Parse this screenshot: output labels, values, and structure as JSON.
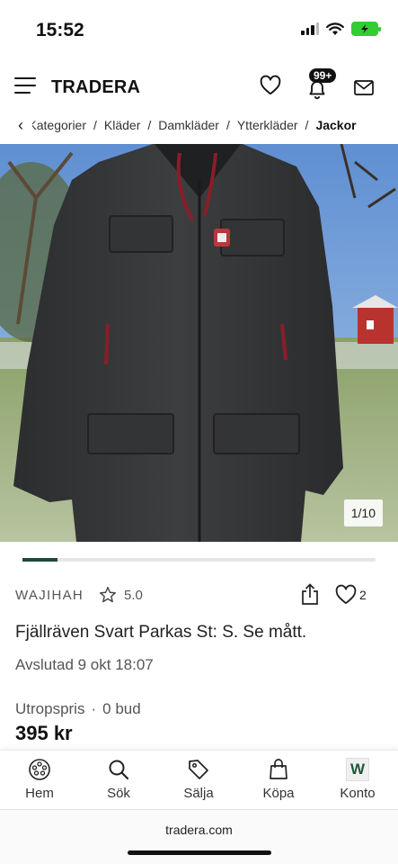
{
  "status": {
    "time": "15:52"
  },
  "header": {
    "logo": "TRADERA",
    "notification_badge": "99+"
  },
  "breadcrumb": {
    "items": [
      "Kategorier",
      "Kläder",
      "Damkläder",
      "Ytterkläder"
    ],
    "current": "Jackor"
  },
  "gallery": {
    "counter": "1/10",
    "current_index": 1,
    "total": 10
  },
  "listing": {
    "seller": "WAJIHAH",
    "rating": "5.0",
    "favorites": "2",
    "title": "Fjällräven Svart Parkas St: S. Se mått.",
    "ended": "Avslutad 9 okt 18:07",
    "price_type": "Utropspris",
    "separator": "·",
    "bids": "0 bud",
    "price": "395 kr"
  },
  "nav": {
    "items": [
      {
        "label": "Hem",
        "icon": "home-icon"
      },
      {
        "label": "Sök",
        "icon": "search-icon"
      },
      {
        "label": "Sälja",
        "icon": "tag-icon"
      },
      {
        "label": "Köpa",
        "icon": "shopping-bag-icon"
      },
      {
        "label": "Konto",
        "icon": "account-icon",
        "letter": "W"
      }
    ]
  },
  "browser": {
    "url": "tradera.com"
  },
  "colors": {
    "brand_green": "#1d4a3a",
    "battery": "#33cc33"
  }
}
